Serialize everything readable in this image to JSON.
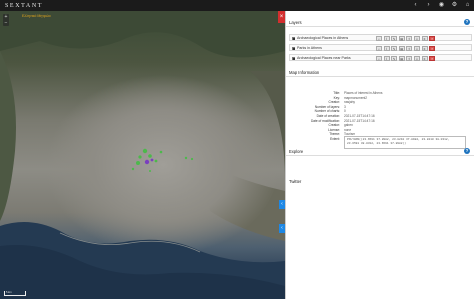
{
  "app": {
    "brand": "SEXTANT",
    "top_icons": [
      "arrow-left-icon",
      "arrow-right-icon",
      "eye-icon",
      "settings-icon",
      "home-icon"
    ]
  },
  "map": {
    "label": "Ελληνικό Μητρώο",
    "zoom_in": "+",
    "zoom_out": "−",
    "scale": "5 km"
  },
  "panel": {
    "layers_title": "Layers",
    "layers": [
      {
        "name": "Archaeological Places in Athens",
        "checked": true
      },
      {
        "name": "Parks in Athens",
        "checked": true
      },
      {
        "name": "Archaeological Places near Parks",
        "checked": true
      }
    ],
    "map_info_title": "Map Information",
    "map_info": [
      {
        "key": "Title:",
        "value": "Places of interest in Athens"
      },
      {
        "key": "Key:",
        "value": "mapmonument2"
      },
      {
        "key": "Creator:",
        "value": "nasjahy"
      },
      {
        "key": "Number of layers:",
        "value": "3"
      },
      {
        "key": "Number of charts:",
        "value": "0"
      },
      {
        "key": "Date of creation:",
        "value": "2021-07-15T14:47:16"
      },
      {
        "key": "Date of modification:",
        "value": "2021-07-15T14:47:16"
      },
      {
        "key": "Creator:",
        "value": "gaben"
      },
      {
        "key": "License:",
        "value": "none"
      },
      {
        "key": "Theme:",
        "value": "Tourism"
      }
    ],
    "extent_label": "Extent:",
    "extent_value": "POLYGON((23.6591 37.8982, 23.8210 37.8982, 23.8210 38.0312, 23.6591 38.0312, 23.6591 37.8982))",
    "explore_title": "Explore",
    "twitter_title": "Twitter"
  },
  "colors": {
    "topbar": "#1b1b1b",
    "help_blue": "#1e73be",
    "delete_red": "#d9534f",
    "side_tab_red": "#d32f2f",
    "side_tab_blue": "#1e88e5"
  }
}
